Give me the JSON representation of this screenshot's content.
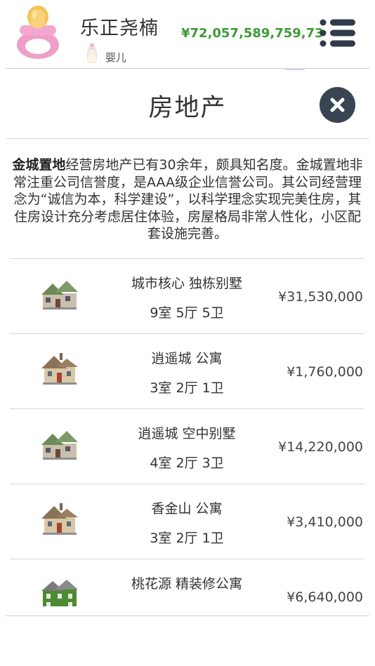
{
  "header": {
    "player_name": "乐正尧楠",
    "money": "¥72,057,589,759,73",
    "life_stage": "婴儿"
  },
  "modal": {
    "title": "房地产",
    "company_name": "金城置地",
    "company_description": "经营房地产已有30余年，颇具知名度。金城置地非常注重公司信誉度，是AAA级企业信誉公司。其公司经营理念为“诚信为本，科学建设”，以科学理念实现完美住房，其住房设计充分考虑居住体验，房屋格局非常人性化，小区配套设施完善。"
  },
  "properties": [
    {
      "name": "城市核心 独栋别墅",
      "rooms": "9室 5厅 5卫",
      "price": "¥31,530,000",
      "icon": "villa-icon",
      "color": "#8f9a7c"
    },
    {
      "name": "逍遥城 公寓",
      "rooms": "3室 2厅 1卫",
      "price": "¥1,760,000",
      "icon": "apartment-icon",
      "color": "#9e8d76"
    },
    {
      "name": "逍遥城 空中别墅",
      "rooms": "4室 2厅 3卫",
      "price": "¥14,220,000",
      "icon": "villa-icon",
      "color": "#8f9a7c"
    },
    {
      "name": "香金山 公寓",
      "rooms": "3室 2厅 1卫",
      "price": "¥3,410,000",
      "icon": "apartment-icon",
      "color": "#9e8d76"
    },
    {
      "name": "桃花源 精装修公寓",
      "rooms": "",
      "price": "¥6,640,000",
      "icon": "green-house-icon",
      "color": "#4c8b2f"
    }
  ]
}
